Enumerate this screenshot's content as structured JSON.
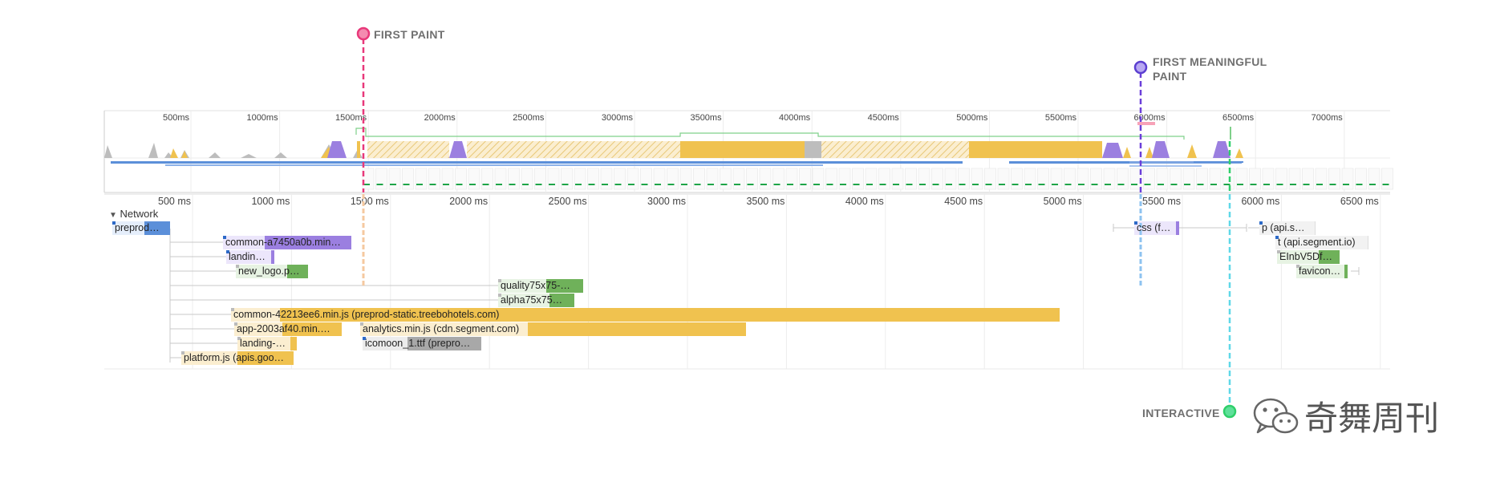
{
  "milestones": {
    "first_paint": "FIRST PAINT",
    "first_meaningful_paint": [
      "FIRST MEANINGFUL",
      "PAINT"
    ],
    "interactive": "INTERACTIVE"
  },
  "overview_ticks": [
    "500ms",
    "1000ms",
    "1500ms",
    "2000ms",
    "2500ms",
    "3000ms",
    "3500ms",
    "4000ms",
    "4500ms",
    "5000ms",
    "5500ms",
    "6000ms",
    "6500ms",
    "7000ms"
  ],
  "detail_ticks": [
    "500 ms",
    "1000 ms",
    "1500 ms",
    "2000 ms",
    "2500 ms",
    "3000 ms",
    "3500 ms",
    "4000 ms",
    "4500 ms",
    "5000 ms",
    "5500 ms",
    "6000 ms",
    "6500 ms"
  ],
  "network": {
    "header": "Network",
    "requests": [
      {
        "label": "preprod…"
      },
      {
        "label": "common-a7450a0b.min…"
      },
      {
        "label": "landin…"
      },
      {
        "label": "new_logo.p…"
      },
      {
        "label": "quality75x75-…"
      },
      {
        "label": "alpha75x75…"
      },
      {
        "label": "common-42213ee6.min.js (preprod-static.treebohotels.com)"
      },
      {
        "label": "app-2003af40.min.…"
      },
      {
        "label": "analytics.min.js (cdn.segment.com)"
      },
      {
        "label": "landing-…"
      },
      {
        "label": "icomoon_1.ttf (prepro…"
      },
      {
        "label": "platform.js (apis.goo…"
      },
      {
        "label": "css (f…"
      },
      {
        "label": "p (api.s…"
      },
      {
        "label": "t (api.segment.io)"
      },
      {
        "label": "EInbV5Df…"
      },
      {
        "label": "favicon…"
      }
    ]
  },
  "watermark": {
    "text": "奇舞周刊"
  },
  "colors": {
    "first_paint": "#e8387a",
    "first_meaningful_paint": "#6b3fd9",
    "interactive": "#2fcf6a",
    "script": "#f0c24f",
    "stylesheet": "#9b7fe0",
    "image": "#6fb15a",
    "html": "#5b8fd9",
    "font": "#a8a8a8"
  }
}
